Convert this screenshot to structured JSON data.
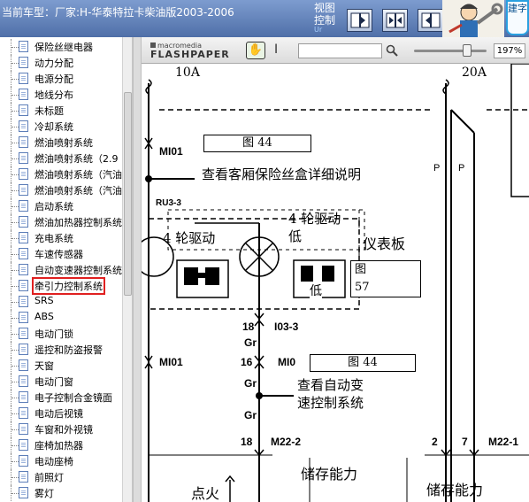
{
  "header": {
    "vehicle_title": "当前车型：厂家:H-华泰特拉卡柴油版2003-2006",
    "view_label_line1": "视图",
    "view_label_line2": "控制",
    "view_sub": "Ur",
    "help_tab": "建字"
  },
  "tree": {
    "items": [
      {
        "label": "保险丝继电器"
      },
      {
        "label": "动力分配"
      },
      {
        "label": "电源分配"
      },
      {
        "label": "地线分布"
      },
      {
        "label": "未标题"
      },
      {
        "label": "冷却系统"
      },
      {
        "label": "燃油喷射系统"
      },
      {
        "label": "燃油喷射系统（2.9"
      },
      {
        "label": "燃油喷射系统（汽油"
      },
      {
        "label": "燃油喷射系统（汽油"
      },
      {
        "label": "启动系统"
      },
      {
        "label": "燃油加热器控制系统"
      },
      {
        "label": "充电系统"
      },
      {
        "label": "车速传感器"
      },
      {
        "label": "自动变速器控制系统"
      },
      {
        "label": "牵引力控制系统",
        "selected": true
      },
      {
        "label": "SRS"
      },
      {
        "label": "ABS"
      },
      {
        "label": "电动门锁"
      },
      {
        "label": "遥控和防盗报警"
      },
      {
        "label": "天窗"
      },
      {
        "label": "电动门窗"
      },
      {
        "label": "电子控制合金镜面"
      },
      {
        "label": "电动后视镜"
      },
      {
        "label": "车窗和外视镜"
      },
      {
        "label": "座椅加热器"
      },
      {
        "label": "电动座椅"
      },
      {
        "label": "前照灯"
      },
      {
        "label": "雾灯"
      }
    ]
  },
  "viewer": {
    "brand_small": "macromedia",
    "brand_big": "FLASHPAPER",
    "search_value": "",
    "zoom_value": "197%",
    "zoom_fraction": 0.73
  },
  "diagram": {
    "fuse_left": "10A",
    "fuse_right": "20A",
    "conn_mi01_top": "MI01",
    "ref_fig44_top": "图 44",
    "note_fuse_box": "查看客厢保险丝盒详细说明",
    "conn_ru3": "RU3-3",
    "label_4wd_high": "4 轮驱动",
    "label_4wd_low_line1": "4 轮驱动",
    "label_4wd_low_line2": "低",
    "label_dashboard": "仪表板",
    "ref_fig57_line1": "图",
    "ref_fig57_line2": "57",
    "label_low": "低",
    "pin_18": "18",
    "conn_i03": "I03-3",
    "wire_gr_1": "Gr",
    "conn_mi01_bottom": "MI01",
    "pin_16": "16",
    "conn_mi0x": "MI0",
    "ref_fig44_bottom": "图 44",
    "wire_gr_2": "Gr",
    "note_auto_trans_line1": "查看自动变",
    "note_auto_trans_line2": "速控制系统",
    "wire_gr_3": "Gr",
    "pin_18b": "18",
    "conn_m22_2": "M22-2",
    "label_storage_1": "储存能力",
    "label_ignition": "点火",
    "label_storage_2": "储存能力",
    "wire_p_1": "P",
    "wire_p_2": "P",
    "pin_2": "2",
    "pin_7": "7",
    "conn_m22_right": "M22-1"
  },
  "colors": {
    "titlebar": "#5b7bb5",
    "selection_border": "#e02020",
    "tree_icon": "#5d7eb8"
  }
}
